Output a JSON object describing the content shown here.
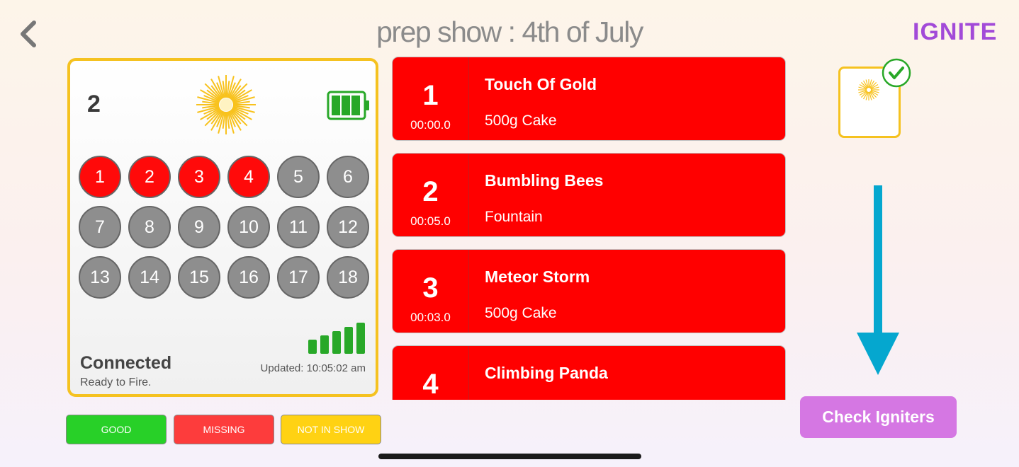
{
  "header": {
    "title": "prep show : 4th of July",
    "logo": "IGNITE",
    "back_icon": "chevron-left-icon"
  },
  "module": {
    "number": "2",
    "status": "Connected",
    "substatus": "Ready to Fire.",
    "updated": "Updated: 10:05:02 am",
    "battery_icon": "battery-full-icon",
    "signal_icon": "signal-strength-icon",
    "firework_icon": "sunburst-icon",
    "cues": [
      {
        "label": "1",
        "state": "red"
      },
      {
        "label": "2",
        "state": "red"
      },
      {
        "label": "3",
        "state": "red"
      },
      {
        "label": "4",
        "state": "red"
      },
      {
        "label": "5",
        "state": "gray"
      },
      {
        "label": "6",
        "state": "gray"
      },
      {
        "label": "7",
        "state": "gray"
      },
      {
        "label": "8",
        "state": "gray"
      },
      {
        "label": "9",
        "state": "gray"
      },
      {
        "label": "10",
        "state": "gray"
      },
      {
        "label": "11",
        "state": "gray"
      },
      {
        "label": "12",
        "state": "gray"
      },
      {
        "label": "13",
        "state": "gray"
      },
      {
        "label": "14",
        "state": "gray"
      },
      {
        "label": "15",
        "state": "gray"
      },
      {
        "label": "16",
        "state": "gray"
      },
      {
        "label": "17",
        "state": "gray"
      },
      {
        "label": "18",
        "state": "gray"
      }
    ]
  },
  "legend": {
    "good": "GOOD",
    "missing": "MISSING",
    "not_in_show": "NOT IN SHOW"
  },
  "cue_list": [
    {
      "number": "1",
      "time": "00:00.0",
      "name": "Touch Of Gold",
      "type": "500g Cake"
    },
    {
      "number": "2",
      "time": "00:05.0",
      "name": "Bumbling Bees",
      "type": "Fountain"
    },
    {
      "number": "3",
      "time": "00:03.0",
      "name": "Meteor Storm",
      "type": "500g Cake"
    },
    {
      "number": "4",
      "time": "",
      "name": "Climbing Panda",
      "type": ""
    }
  ],
  "colors": {
    "accent": "#d577e3",
    "cue_red": "#ff0000",
    "cue_gray": "#8e8e8e",
    "module_border": "#f5c220",
    "good": "#28d028",
    "missing": "#fd3c3c",
    "not_in_show": "#ffd213",
    "arrow": "#05a7cf"
  },
  "check_button": {
    "label": "Check Igniters"
  },
  "mini_module": {
    "check_icon": "check-circle-icon"
  },
  "arrow": {
    "icon": "arrow-down-icon"
  }
}
